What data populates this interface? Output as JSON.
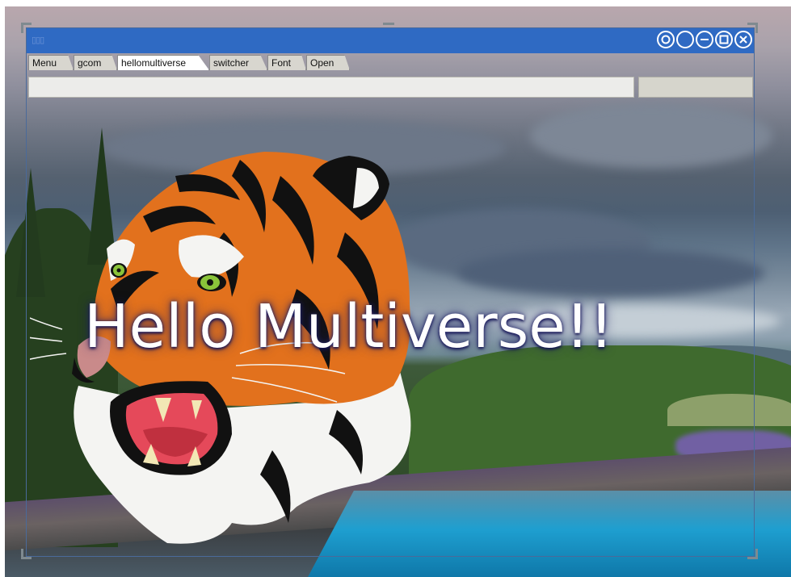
{
  "window": {
    "app_icon_glyph": "▯▯▯",
    "controls": [
      "record-icon",
      "circle-icon",
      "minimize-icon",
      "maximize-icon",
      "close-icon"
    ]
  },
  "tabs": [
    {
      "label": "Menu",
      "active": false
    },
    {
      "label": "gcom",
      "active": false
    },
    {
      "label": "hellomultiverse",
      "active": true
    },
    {
      "label": "switcher",
      "active": false
    },
    {
      "label": "Font",
      "active": false
    },
    {
      "label": "Open",
      "active": false
    }
  ],
  "command": {
    "value": "",
    "button_label": ""
  },
  "content": {
    "greeting": "Hello Multiverse!!"
  },
  "colors": {
    "titlebar": "#2f6ac3",
    "tab_bg": "#d8d6cf",
    "tab_active_bg": "#ffffff",
    "tiger_orange": "#e2711d",
    "greeting_text": "#ffffff"
  }
}
